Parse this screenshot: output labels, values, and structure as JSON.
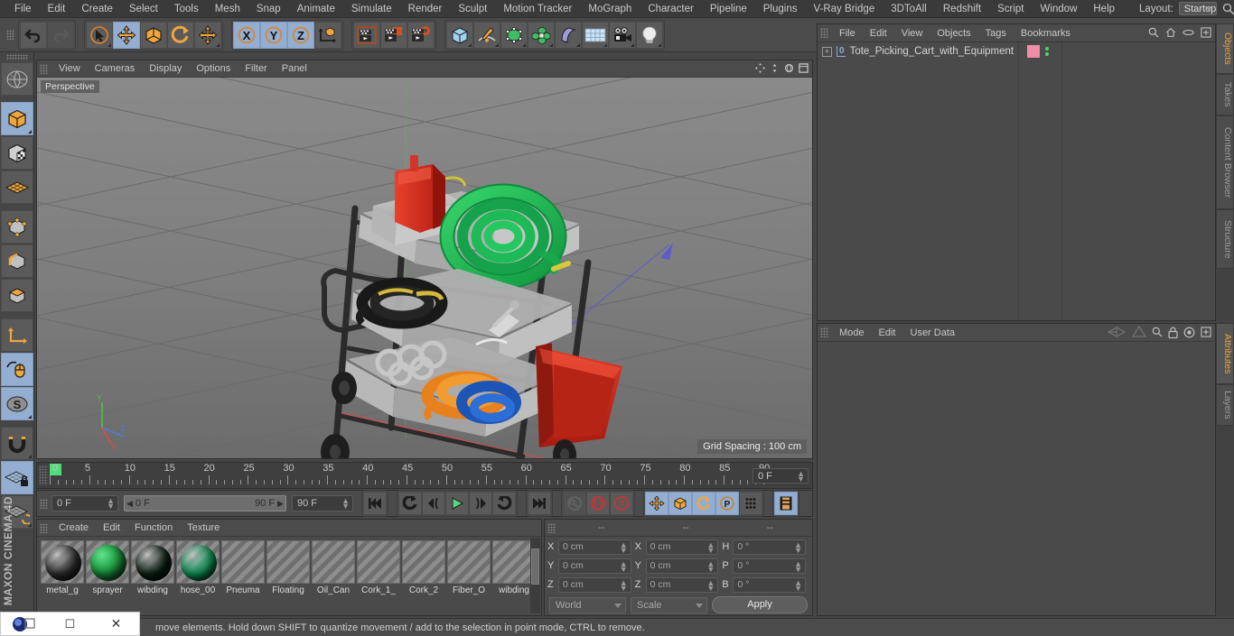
{
  "app": {
    "brand": "MAXON CINEMA 4D",
    "brand_line1": "MAXON",
    "brand_line2": "CINEMA 4D"
  },
  "menubar": {
    "items": [
      "File",
      "Edit",
      "Create",
      "Select",
      "Tools",
      "Mesh",
      "Snap",
      "Animate",
      "Simulate",
      "Render",
      "Sculpt",
      "Motion Tracker",
      "MoGraph",
      "Character",
      "Pipeline",
      "Plugins",
      "V-Ray Bridge",
      "3DToAll",
      "Redshift",
      "Script",
      "Window",
      "Help"
    ],
    "layout_label": "Layout:",
    "layout_value": "Startup",
    "search_icon": "search-icon"
  },
  "toolbar": {
    "groups": [
      {
        "name": "history",
        "buttons": [
          {
            "name": "undo-button",
            "icon": "undo-icon",
            "selected": false,
            "dim": false
          },
          {
            "name": "redo-button",
            "icon": "redo-icon",
            "selected": false,
            "dim": true
          }
        ]
      },
      {
        "name": "transform",
        "buttons": [
          {
            "name": "live-selection-tool",
            "icon": "cursor-circle-icon",
            "selected": false,
            "dim": false
          },
          {
            "name": "move-tool",
            "icon": "move-arrows-icon",
            "selected": true,
            "dim": false
          },
          {
            "name": "scale-tool",
            "icon": "scale-box-icon",
            "selected": false,
            "dim": false
          },
          {
            "name": "rotate-tool",
            "icon": "rotate-arc-icon",
            "selected": false,
            "dim": false
          },
          {
            "name": "transform-tool",
            "icon": "move-arrows-icon",
            "selected": false,
            "dim": false
          }
        ]
      },
      {
        "name": "axis-locks",
        "buttons": [
          {
            "name": "lock-x-axis-button",
            "icon": "x-axis-icon",
            "selected": true,
            "dim": false
          },
          {
            "name": "lock-y-axis-button",
            "icon": "y-axis-icon",
            "selected": true,
            "dim": false
          },
          {
            "name": "lock-z-axis-button",
            "icon": "z-axis-icon",
            "selected": true,
            "dim": false
          },
          {
            "name": "world-object-coordinate-button",
            "icon": "world-axis-cube-icon",
            "selected": false,
            "dim": false
          }
        ]
      },
      {
        "name": "render",
        "buttons": [
          {
            "name": "render-view-button",
            "icon": "clapper-view-icon",
            "selected": false,
            "dim": false
          },
          {
            "name": "render-to-picture-viewer-button",
            "icon": "clapper-picture-icon",
            "selected": false,
            "dim": false
          },
          {
            "name": "render-settings-button",
            "icon": "clapper-gear-icon",
            "selected": false,
            "dim": false
          }
        ]
      },
      {
        "name": "objects",
        "buttons": [
          {
            "name": "add-cube-button",
            "icon": "cube-icon",
            "selected": false,
            "dim": false
          },
          {
            "name": "add-spline-button",
            "icon": "pen-spline-icon",
            "selected": false,
            "dim": false
          },
          {
            "name": "add-generator-button",
            "icon": "green-cube-generator-icon",
            "selected": false,
            "dim": false
          },
          {
            "name": "add-array-button",
            "icon": "green-array-icon",
            "selected": false,
            "dim": false
          },
          {
            "name": "add-deformer-button",
            "icon": "bend-deformer-icon",
            "selected": false,
            "dim": false
          },
          {
            "name": "add-scene-environment-button",
            "icon": "floor-grid-icon",
            "selected": false,
            "dim": false
          },
          {
            "name": "add-camera-button",
            "icon": "camera-icon",
            "selected": false,
            "dim": false
          },
          {
            "name": "add-light-button",
            "icon": "light-bulb-icon",
            "selected": false,
            "dim": false
          }
        ]
      }
    ]
  },
  "left_toolbar": {
    "buttons": [
      {
        "name": "make-editable-button",
        "icon": "globe-wire-icon",
        "selected": false
      },
      {
        "name": "model-mode-button",
        "icon": "orange-cube-icon",
        "selected": true
      },
      {
        "name": "texture-mode-button",
        "icon": "checker-cube-icon",
        "selected": false
      },
      {
        "name": "workplane-mode-button",
        "icon": "orange-grid-icon",
        "selected": false
      },
      {
        "name": "point-mode-button",
        "icon": "point-cube-icon",
        "selected": false
      },
      {
        "name": "edge-mode-button",
        "icon": "edge-cube-icon",
        "selected": false
      },
      {
        "name": "polygon-mode-button",
        "icon": "polygon-cube-icon",
        "selected": false
      },
      {
        "name": "object-axis-mode-button",
        "icon": "axis-l-icon",
        "selected": false
      },
      {
        "name": "enable-axis-modification-button",
        "icon": "mouse-icon",
        "selected": true
      },
      {
        "name": "soft-selection-button",
        "icon": "s-circle-icon",
        "selected": true
      },
      {
        "name": "enable-snapping-button",
        "icon": "magnet-icon",
        "selected": false
      },
      {
        "name": "lock-workplane-button",
        "icon": "grid-lock-icon",
        "selected": true
      },
      {
        "name": "planar-workplane-button",
        "icon": "grid-rotate-icon",
        "selected": false
      }
    ]
  },
  "viewport": {
    "menu_items": [
      "View",
      "Cameras",
      "Display",
      "Options",
      "Filter",
      "Panel"
    ],
    "perspective_label": "Perspective",
    "grid_spacing": "Grid Spacing : 100 cm",
    "icons": [
      "pan-icon",
      "zoom-icon",
      "rotate-view-icon",
      "maximize-view-icon"
    ]
  },
  "timeline": {
    "frame_numbers": [
      "0",
      "5",
      "10",
      "15",
      "20",
      "25",
      "30",
      "35",
      "40",
      "45",
      "50",
      "55",
      "60",
      "65",
      "70",
      "75",
      "80",
      "85",
      "90"
    ],
    "current_frame_field": "0 F",
    "start": 0,
    "end": 90
  },
  "transport": {
    "current_frame": "0 F",
    "preview_min": "0 F",
    "preview_max": "90 F",
    "max_frame": "90 F",
    "buttons": [
      {
        "name": "go-to-start-button",
        "icon": "skip-start-icon",
        "selected": false,
        "dim": false
      },
      {
        "name": "previous-key-button",
        "icon": "prev-key-icon",
        "selected": false,
        "dim": false
      },
      {
        "name": "step-back-button",
        "icon": "step-back-icon",
        "selected": false,
        "dim": false
      },
      {
        "name": "play-button",
        "icon": "play-icon",
        "selected": false,
        "dim": false
      },
      {
        "name": "step-forward-button",
        "icon": "step-forward-icon",
        "selected": false,
        "dim": false
      },
      {
        "name": "next-key-button",
        "icon": "next-key-icon",
        "selected": false,
        "dim": false
      },
      {
        "name": "go-to-end-button",
        "icon": "skip-end-icon",
        "selected": false,
        "dim": false
      },
      {
        "name": "record-active-objects-button",
        "icon": "key-icon",
        "selected": false,
        "dim": true
      },
      {
        "name": "autokeying-button",
        "icon": "autokey-circle-icon",
        "selected": false,
        "dim": false
      },
      {
        "name": "keyframe-selection-button",
        "icon": "question-circle-icon",
        "selected": false,
        "dim": false
      },
      {
        "name": "record-position-button",
        "icon": "move-arrows-icon",
        "selected": true,
        "dim": false
      },
      {
        "name": "record-scale-button",
        "icon": "scale-box-icon",
        "selected": true,
        "dim": false
      },
      {
        "name": "record-rotation-button",
        "icon": "rotate-arc-icon",
        "selected": true,
        "dim": false
      },
      {
        "name": "record-pla-button",
        "icon": "p-circle-icon",
        "selected": true,
        "dim": false
      },
      {
        "name": "record-point-level-animation-button",
        "icon": "dots-grid-icon",
        "selected": false,
        "dim": false
      },
      {
        "name": "timeline-view-button",
        "icon": "filmstrip-icon",
        "selected": true,
        "dim": false
      }
    ]
  },
  "material_manager": {
    "menu_items": [
      "Create",
      "Edit",
      "Function",
      "Texture"
    ],
    "materials": [
      {
        "name": "metal_g",
        "swatch": "#2e2e2e",
        "type": "sphere"
      },
      {
        "name": "sprayer",
        "swatch": "#1f9c41",
        "type": "sphere-pattern"
      },
      {
        "name": "wibding",
        "swatch": "#0d1f14",
        "type": "sphere"
      },
      {
        "name": "hose_00",
        "swatch": "#0f9257",
        "type": "sphere"
      },
      {
        "name": "Pneuma",
        "swatch": "",
        "type": "empty"
      },
      {
        "name": "Floating",
        "swatch": "",
        "type": "empty"
      },
      {
        "name": "Oil_Can",
        "swatch": "",
        "type": "empty"
      },
      {
        "name": "Cork_1_",
        "swatch": "",
        "type": "empty"
      },
      {
        "name": "Cork_2",
        "swatch": "",
        "type": "empty"
      },
      {
        "name": "Fiber_O",
        "swatch": "",
        "type": "empty"
      },
      {
        "name": "wibding",
        "swatch": "",
        "type": "empty"
      }
    ]
  },
  "coordinates": {
    "col_headers": [
      "--",
      "--",
      "--"
    ],
    "rows": [
      {
        "pos_label": "X",
        "pos_value": "0 cm",
        "size_label": "X",
        "size_value": "0 cm",
        "rot_label": "H",
        "rot_value": "0 °"
      },
      {
        "pos_label": "Y",
        "pos_value": "0 cm",
        "size_label": "Y",
        "size_value": "0 cm",
        "rot_label": "P",
        "rot_value": "0 °"
      },
      {
        "pos_label": "Z",
        "pos_value": "0 cm",
        "size_label": "Z",
        "size_value": "0 cm",
        "rot_label": "B",
        "rot_value": "0 °"
      }
    ],
    "coord_system": "World",
    "size_mode": "Scale",
    "apply_label": "Apply"
  },
  "object_manager": {
    "menu_items": [
      "File",
      "Edit",
      "View",
      "Objects",
      "Tags",
      "Bookmarks"
    ],
    "icons": [
      "search-icon",
      "home-icon",
      "ellipse-icon",
      "expand-icon"
    ],
    "objects": [
      {
        "name": "Tote_Picking_Cart_with_Equipment",
        "layer_badge": "0",
        "tag_color": "#f08ba8"
      }
    ]
  },
  "attribute_manager": {
    "menu_items": [
      "Mode",
      "Edit",
      "User Data"
    ],
    "icons": [
      "history-back-icon",
      "history-forward-icon",
      "search-icon",
      "lock-icon",
      "target-icon",
      "expand-icon"
    ]
  },
  "right_tabs": {
    "top": [
      {
        "label": "Objects",
        "active": true
      },
      {
        "label": "Takes",
        "active": false
      },
      {
        "label": "Content Browser",
        "active": false
      },
      {
        "label": "Structure",
        "active": false
      }
    ],
    "bottom": [
      {
        "label": "Attributes",
        "active": true
      },
      {
        "label": "Layers",
        "active": false
      }
    ]
  },
  "statusbar": {
    "message": "move elements. Hold down SHIFT to quantize movement / add to the selection in point mode, CTRL to remove."
  },
  "taskbar": {
    "items": [
      {
        "name": "app-icon",
        "label": ""
      },
      {
        "name": "restore-window-button",
        "label": "❐"
      },
      {
        "name": "maximize-window-button",
        "label": "☐"
      },
      {
        "name": "close-window-button",
        "label": "✕"
      }
    ]
  }
}
